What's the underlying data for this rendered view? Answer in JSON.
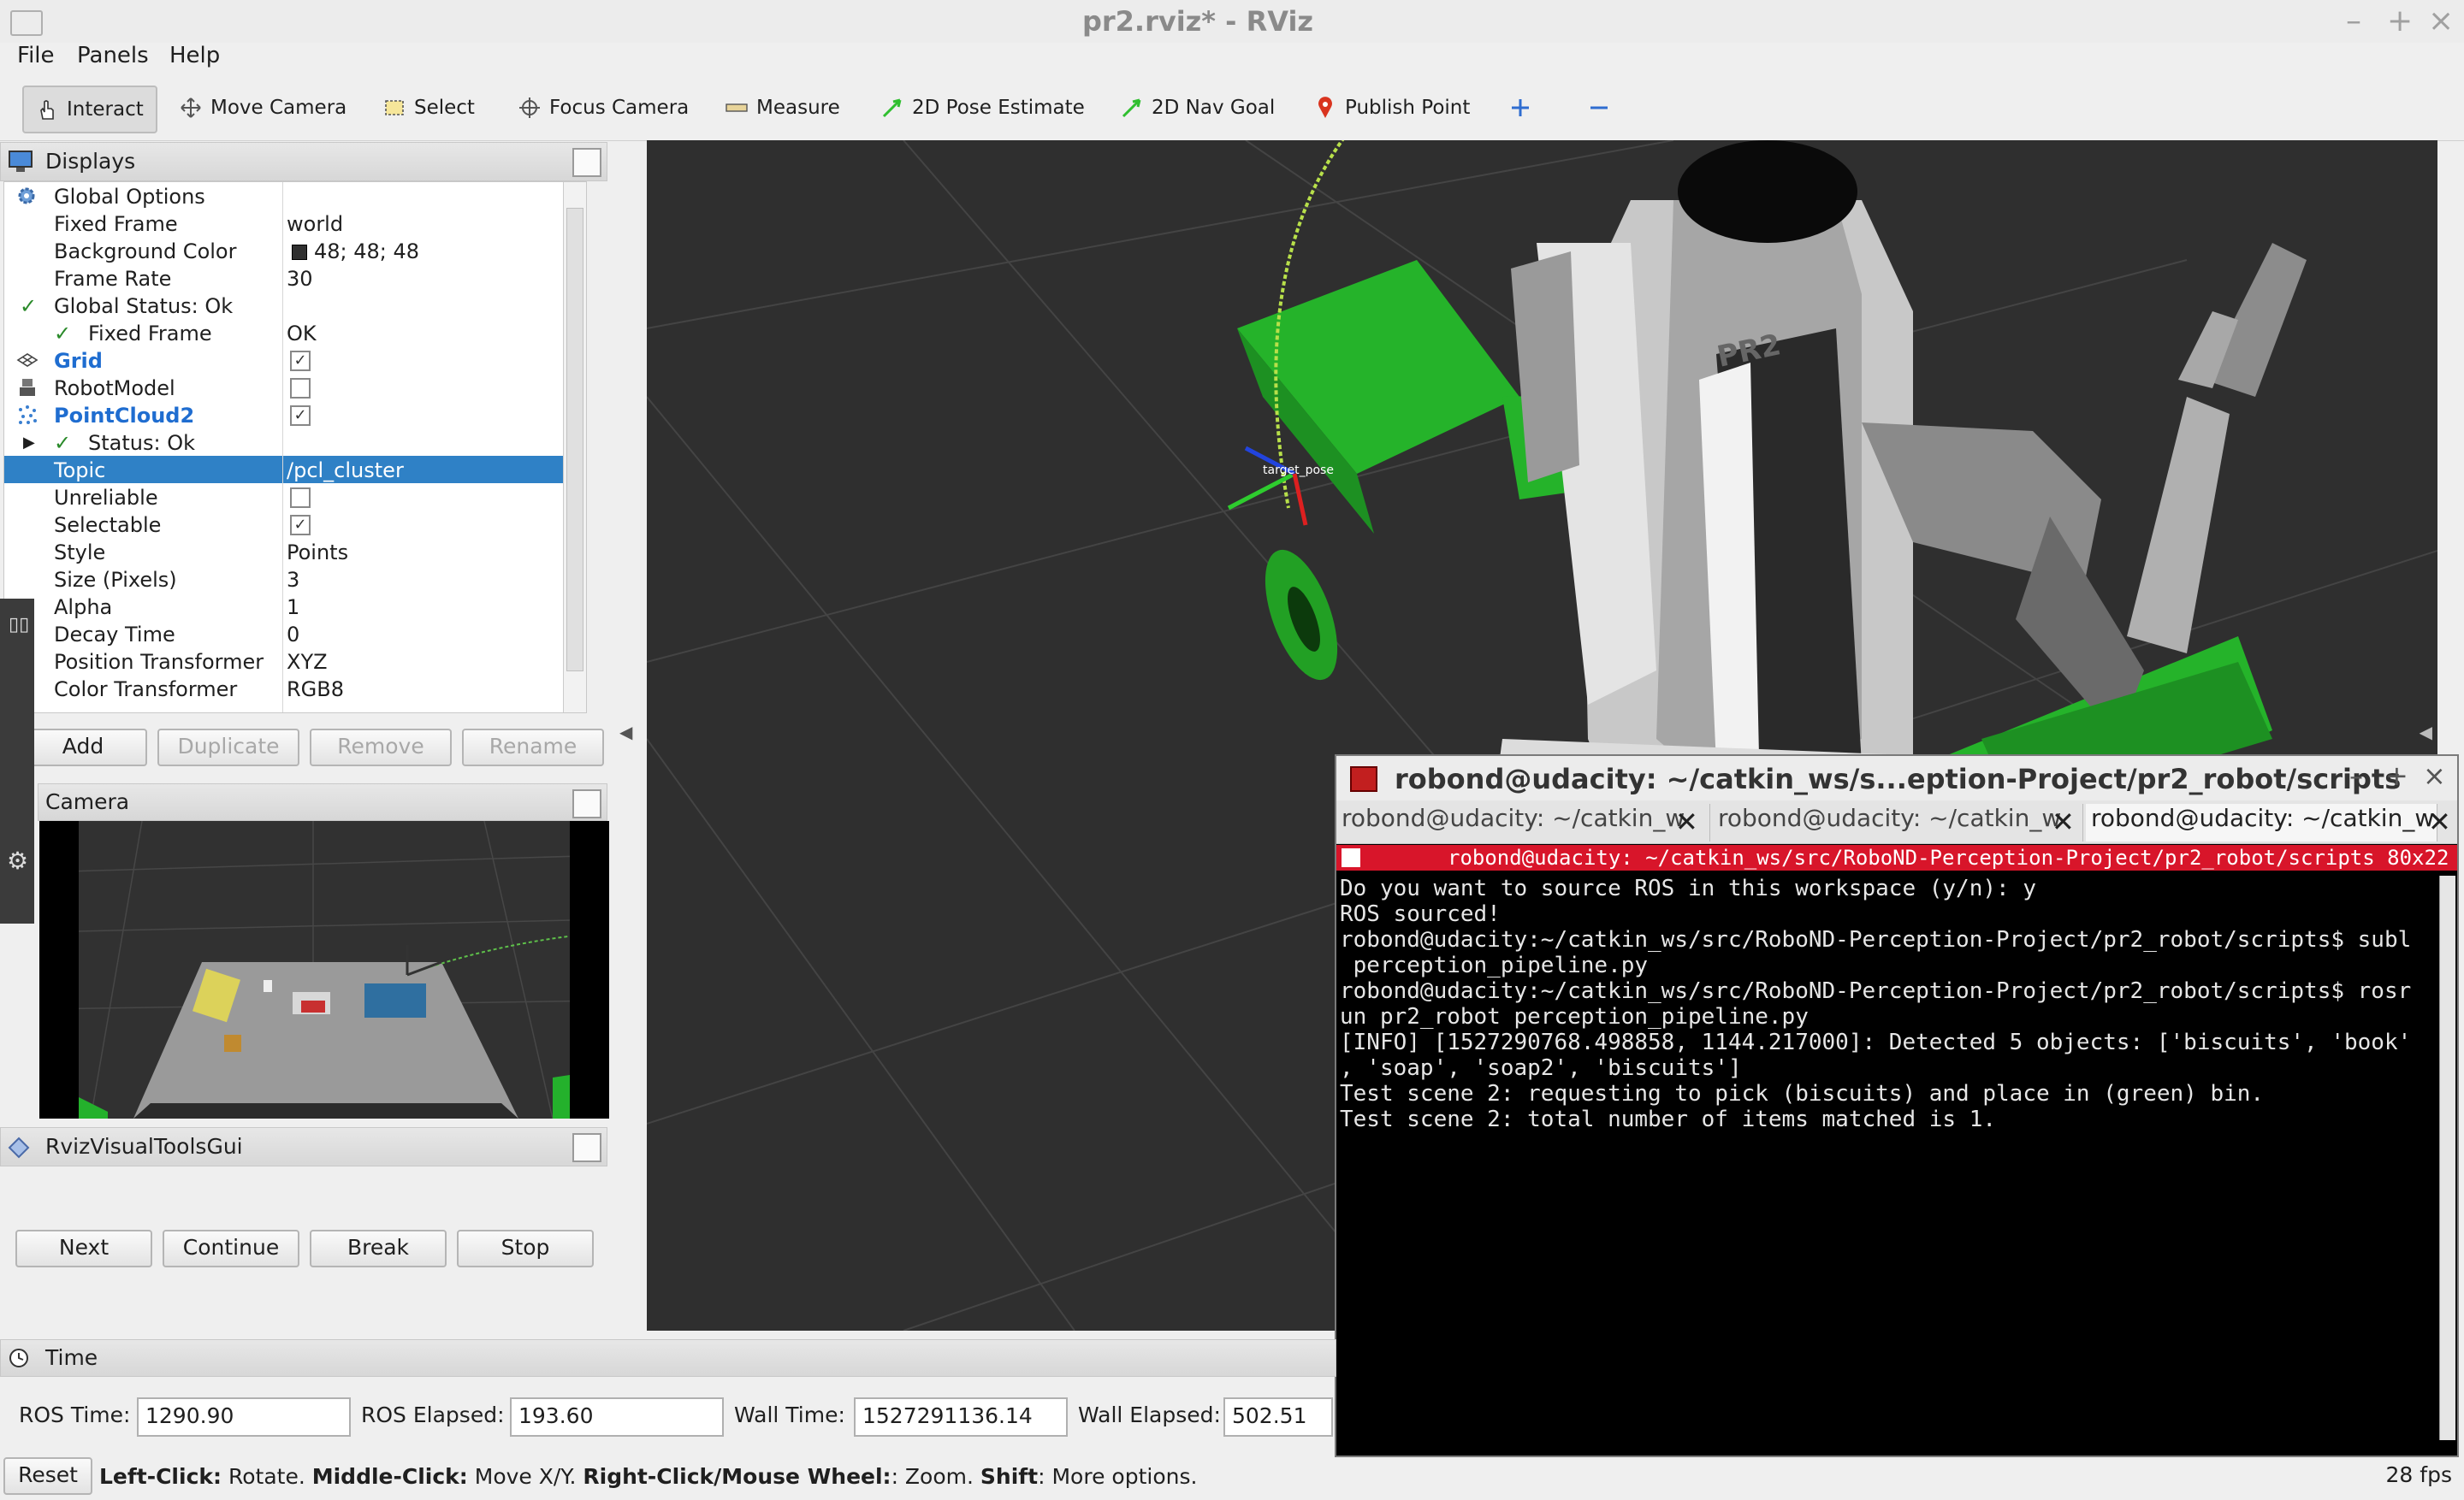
{
  "window": {
    "title": "pr2.rviz* - RViz"
  },
  "menu": [
    "File",
    "Panels",
    "Help"
  ],
  "toolbar": {
    "tools": [
      "Interact",
      "Move Camera",
      "Select",
      "Focus Camera",
      "Measure",
      "2D Pose Estimate",
      "2D Nav Goal",
      "Publish Point"
    ]
  },
  "displays": {
    "title": "Displays",
    "rows": [
      {
        "key": "Global Options",
        "value": ""
      },
      {
        "key": "Fixed Frame",
        "value": "world"
      },
      {
        "key": "Background Color",
        "value": "48; 48; 48"
      },
      {
        "key": "Frame Rate",
        "value": "30"
      },
      {
        "key": "Global Status: Ok",
        "value": ""
      },
      {
        "key": "Fixed Frame",
        "value": "OK"
      },
      {
        "key": "Grid",
        "value": ""
      },
      {
        "key": "RobotModel",
        "value": ""
      },
      {
        "key": "PointCloud2",
        "value": ""
      },
      {
        "key": "Status: Ok",
        "value": ""
      },
      {
        "key": "Topic",
        "value": "/pcl_cluster"
      },
      {
        "key": "Unreliable",
        "value": ""
      },
      {
        "key": "Selectable",
        "value": ""
      },
      {
        "key": "Style",
        "value": "Points"
      },
      {
        "key": "Size (Pixels)",
        "value": "3"
      },
      {
        "key": "Alpha",
        "value": "1"
      },
      {
        "key": "Decay Time",
        "value": "0"
      },
      {
        "key": "Position Transformer",
        "value": "XYZ"
      },
      {
        "key": "Color Transformer",
        "value": "RGB8"
      }
    ],
    "buttons": [
      "Add",
      "Duplicate",
      "Remove",
      "Rename"
    ]
  },
  "camera": {
    "title": "Camera"
  },
  "visual_tools": {
    "title": "RvizVisualToolsGui",
    "buttons": [
      "Next",
      "Continue",
      "Break",
      "Stop"
    ]
  },
  "terminal": {
    "title": "robond@udacity: ~/catkin_ws/s...eption-Project/pr2_robot/scripts",
    "tabs": [
      "robond@udacity: ~/catkin_w",
      "robond@udacity: ~/catkin_w",
      "robond@udacity: ~/catkin_w"
    ],
    "status": "robond@udacity: ~/catkin_ws/src/RoboND-Perception-Project/pr2_robot/scripts 80x22",
    "lines": [
      "Do you want to source ROS in this workspace (y/n): y",
      "ROS sourced!",
      "robond@udacity:~/catkin_ws/src/RoboND-Perception-Project/pr2_robot/scripts$ subl",
      " perception_pipeline.py",
      "robond@udacity:~/catkin_ws/src/RoboND-Perception-Project/pr2_robot/scripts$ rosr",
      "un pr2_robot perception_pipeline.py",
      "[INFO] [1527290768.498858, 1144.217000]: Detected 5 objects: ['biscuits', 'book'",
      ", 'soap', 'soap2', 'biscuits']",
      "Test scene 2: requesting to pick (biscuits) and place in (green) bin.",
      "Test scene 2: total number of items matched is 1."
    ]
  },
  "viewport": {
    "frame_label": "target_pose",
    "robot_label": "PR2"
  },
  "time": {
    "title": "Time",
    "ros_time_label": "ROS Time:",
    "ros_time": "1290.90",
    "ros_elapsed_label": "ROS Elapsed:",
    "ros_elapsed": "193.60",
    "wall_time_label": "Wall Time:",
    "wall_time": "1527291136.14",
    "wall_elapsed_label": "Wall Elapsed:",
    "wall_elapsed": "502.51"
  },
  "status": {
    "reset": "Reset",
    "hint_parts": [
      "Left-Click:",
      " Rotate. ",
      "Middle-Click:",
      " Move X/Y. ",
      "Right-Click/Mouse Wheel:",
      ": Zoom. ",
      "Shift",
      ": More options."
    ],
    "fps": "28 fps"
  },
  "colors": {
    "accent": "#2f81c6",
    "terminal_status": "#d8152a",
    "bin_green": "#26b52c",
    "viewport_bg": "#303030"
  }
}
